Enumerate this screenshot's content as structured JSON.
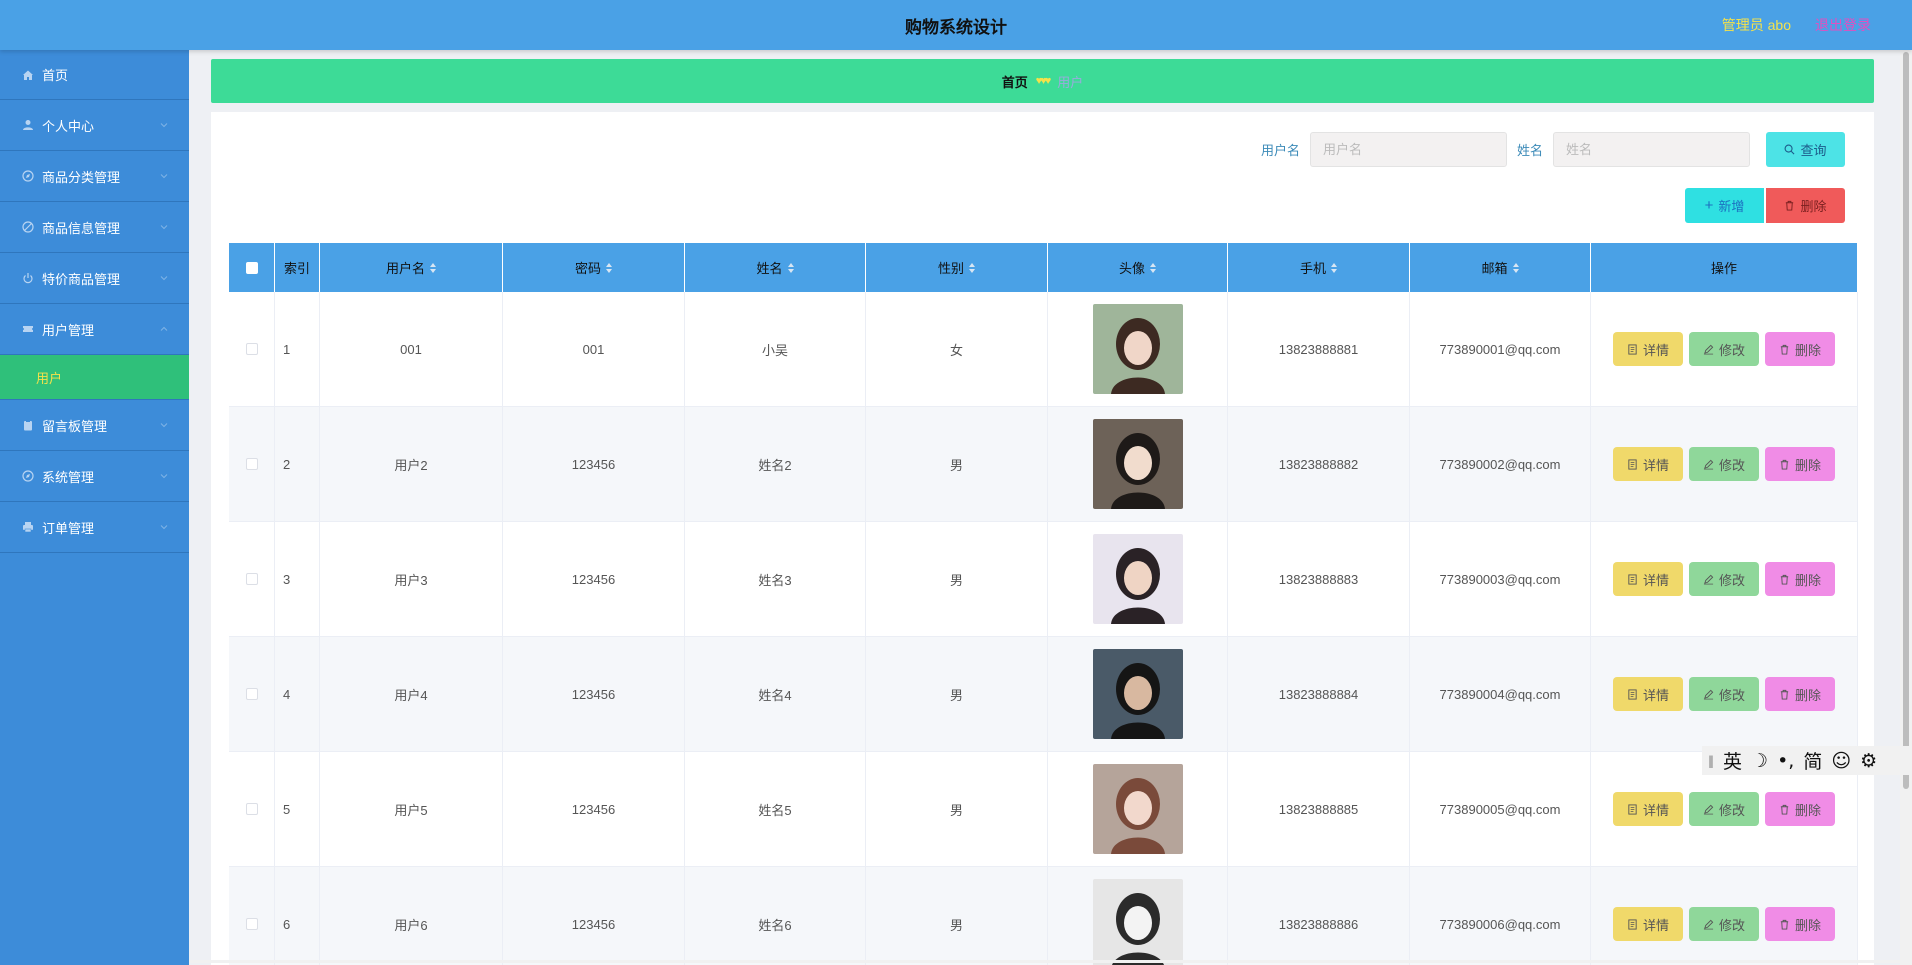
{
  "header": {
    "title": "购物系统设计",
    "admin_label": "管理员 abo",
    "logout_label": "退出登录"
  },
  "sidebar": {
    "items": [
      {
        "label": "首页",
        "icon": "home-icon"
      },
      {
        "label": "个人中心",
        "icon": "user-icon"
      },
      {
        "label": "商品分类管理",
        "icon": "compass-icon"
      },
      {
        "label": "商品信息管理",
        "icon": "slash-circle-icon"
      },
      {
        "label": "特价商品管理",
        "icon": "power-icon"
      },
      {
        "label": "用户管理",
        "icon": "ticket-icon",
        "expanded": true
      },
      {
        "label": "留言板管理",
        "icon": "clipboard-icon"
      },
      {
        "label": "系统管理",
        "icon": "compass-icon"
      },
      {
        "label": "订单管理",
        "icon": "printer-icon"
      }
    ],
    "sub_item": "用户"
  },
  "breadcrumb": {
    "home": "首页",
    "separator": "♥♥♥",
    "current": "用户"
  },
  "search": {
    "username_label": "用户名",
    "username_placeholder": "用户名",
    "name_label": "姓名",
    "name_placeholder": "姓名",
    "query_button": "查询"
  },
  "actions": {
    "add": "新增",
    "delete": "删除"
  },
  "table": {
    "headers": [
      "索引",
      "用户名",
      "密码",
      "姓名",
      "性别",
      "头像",
      "手机",
      "邮箱",
      "操作"
    ],
    "row_actions": {
      "detail": "详情",
      "edit": "修改",
      "delete": "删除"
    },
    "rows": [
      {
        "index": "1",
        "username": "001",
        "password": "001",
        "name": "小吴",
        "sex": "女",
        "phone": "13823888881",
        "email": "773890001@qq.com"
      },
      {
        "index": "2",
        "username": "用户2",
        "password": "123456",
        "name": "姓名2",
        "sex": "男",
        "phone": "13823888882",
        "email": "773890002@qq.com"
      },
      {
        "index": "3",
        "username": "用户3",
        "password": "123456",
        "name": "姓名3",
        "sex": "男",
        "phone": "13823888883",
        "email": "773890003@qq.com"
      },
      {
        "index": "4",
        "username": "用户4",
        "password": "123456",
        "name": "姓名4",
        "sex": "男",
        "phone": "13823888884",
        "email": "773890004@qq.com"
      },
      {
        "index": "5",
        "username": "用户5",
        "password": "123456",
        "name": "姓名5",
        "sex": "男",
        "phone": "13823888885",
        "email": "773890005@qq.com"
      },
      {
        "index": "6",
        "username": "用户6",
        "password": "123456",
        "name": "姓名6",
        "sex": "男",
        "phone": "13823888886",
        "email": "773890006@qq.com"
      }
    ]
  },
  "ime": {
    "lang": "英",
    "moon": "☽",
    "punct": "•,",
    "script": "简",
    "emoji": "☺",
    "settings": "⚙"
  },
  "colors": {
    "header": "#4aa1e6",
    "sidebar": "#3d8cd9",
    "breadcrumb": "#3ddb97",
    "active_sub": "#2fc07a",
    "table_head": "#4aa1e6"
  }
}
